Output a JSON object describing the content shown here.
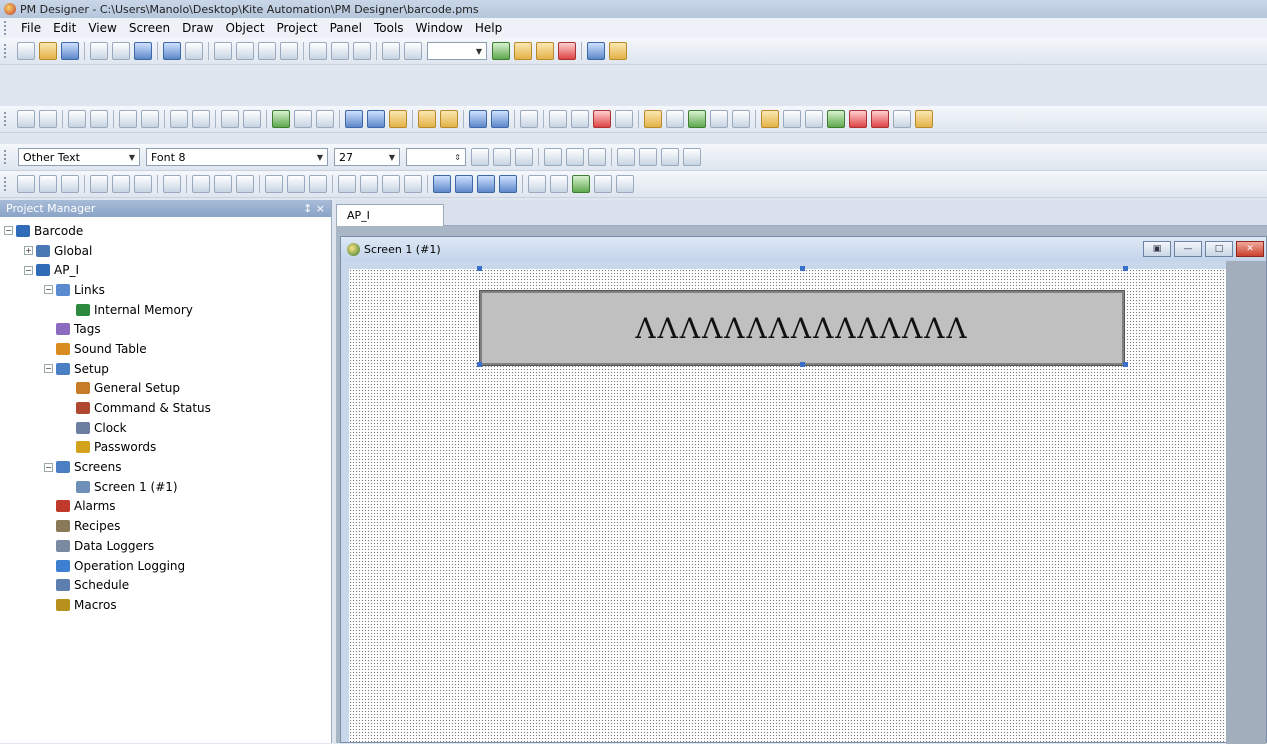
{
  "window": {
    "title": "PM Designer - C:\\Users\\Manolo\\Desktop\\Kite Automation\\PM Designer\\barcode.pms"
  },
  "menu": [
    "File",
    "Edit",
    "View",
    "Screen",
    "Draw",
    "Object",
    "Project",
    "Panel",
    "Tools",
    "Window",
    "Help"
  ],
  "format_toolbar": {
    "text_type": "Other Text",
    "font": "Font 8",
    "size": "27"
  },
  "project_manager": {
    "title": "Project Manager",
    "pin_close": "↕ ×",
    "tree": [
      {
        "label": "Barcode",
        "indent": 0,
        "name": "tree-barcode",
        "color": "#2f6bb7"
      },
      {
        "label": "Global",
        "indent": 1,
        "name": "tree-global",
        "color": "#4a78b5"
      },
      {
        "label": "AP_I",
        "indent": 1,
        "name": "tree-ap-i",
        "color": "#2f6bb7"
      },
      {
        "label": "Links",
        "indent": 2,
        "name": "tree-links",
        "color": "#5a8bd0"
      },
      {
        "label": "Internal Memory",
        "indent": 3,
        "name": "tree-internal-memory",
        "color": "#2b8a3e"
      },
      {
        "label": "Tags",
        "indent": 2,
        "name": "tree-tags",
        "color": "#8a6bbf"
      },
      {
        "label": "Sound Table",
        "indent": 2,
        "name": "tree-sound-table",
        "color": "#d98c1f"
      },
      {
        "label": "Setup",
        "indent": 2,
        "name": "tree-setup",
        "color": "#4b7fc4"
      },
      {
        "label": "General Setup",
        "indent": 3,
        "name": "tree-general-setup",
        "color": "#c77c2a"
      },
      {
        "label": "Command & Status",
        "indent": 3,
        "name": "tree-command-status",
        "color": "#b0472f"
      },
      {
        "label": "Clock",
        "indent": 3,
        "name": "tree-clock",
        "color": "#6d7fa0"
      },
      {
        "label": "Passwords",
        "indent": 3,
        "name": "tree-passwords",
        "color": "#d3a21c"
      },
      {
        "label": "Screens",
        "indent": 2,
        "name": "tree-screens",
        "color": "#4b7fc4"
      },
      {
        "label": "Screen 1 (#1)",
        "indent": 3,
        "name": "tree-screen-1",
        "color": "#6d8fb8"
      },
      {
        "label": "Alarms",
        "indent": 2,
        "name": "tree-alarms",
        "color": "#c0392b"
      },
      {
        "label": "Recipes",
        "indent": 2,
        "name": "tree-recipes",
        "color": "#8a7a5a"
      },
      {
        "label": "Data Loggers",
        "indent": 2,
        "name": "tree-data-loggers",
        "color": "#7a8aa0"
      },
      {
        "label": "Operation Logging",
        "indent": 2,
        "name": "tree-operation-logging",
        "color": "#3d7fd1"
      },
      {
        "label": "Schedule",
        "indent": 2,
        "name": "tree-schedule",
        "color": "#5d7fb0"
      },
      {
        "label": "Macros",
        "indent": 2,
        "name": "tree-macros",
        "color": "#b8901c"
      }
    ]
  },
  "document": {
    "tab": "AP_I",
    "screen_title": "Screen 1 (#1)",
    "text_object": "ΛΛΛΛΛΛΛΛΛΛΛΛΛΛΛ"
  }
}
